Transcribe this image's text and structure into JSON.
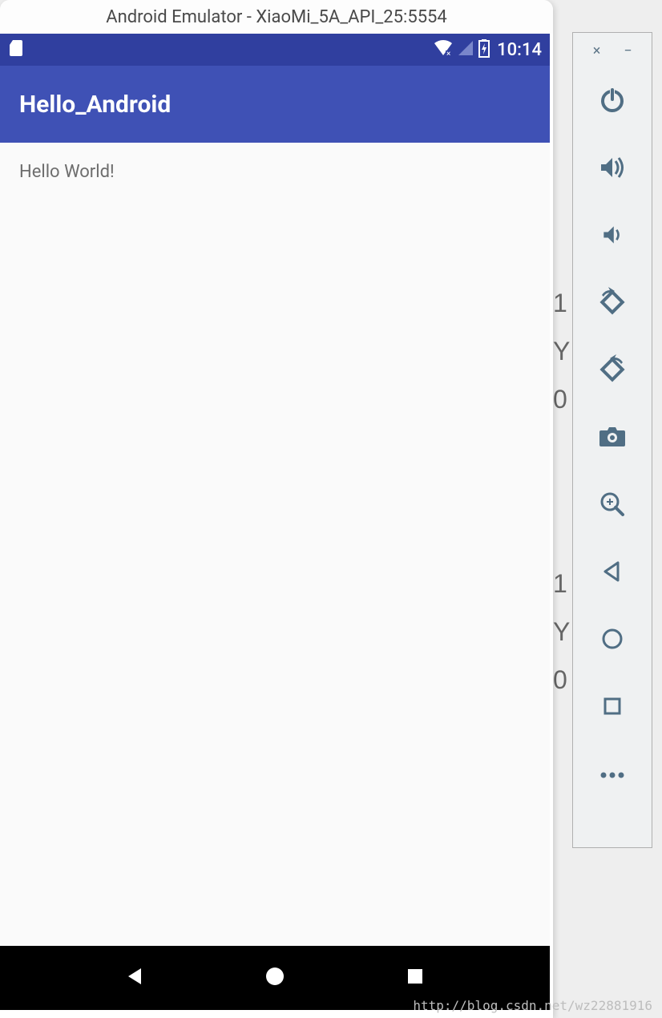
{
  "emulator": {
    "title": "Android Emulator - XiaoMi_5A_API_25:5554"
  },
  "status_bar": {
    "time": "10:14"
  },
  "app_bar": {
    "title": "Hello_Android"
  },
  "content": {
    "text": "Hello World!"
  },
  "side_toolbar": {
    "close": "×",
    "minimize": "−"
  },
  "watermark": "http://blog.csdn.net/wz22881916",
  "background_fragments": {
    "t1": "1",
    "t2": "Y",
    "t3": "0",
    "t4": "1",
    "t5": "Y",
    "t6": "0"
  }
}
